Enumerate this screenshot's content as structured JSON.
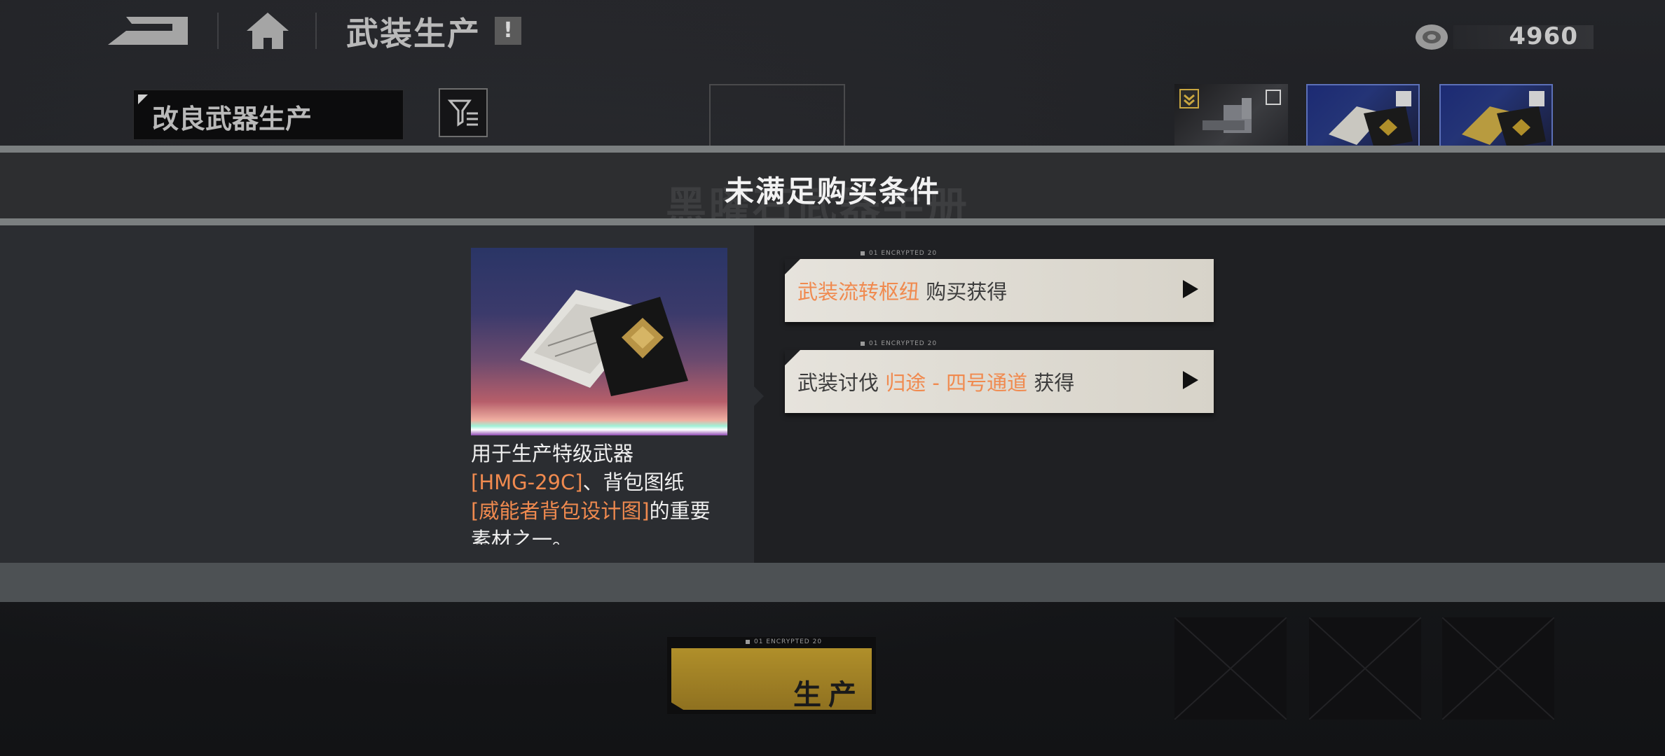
{
  "header": {
    "title": "武装生产",
    "badge": "!",
    "currency_value": "4960"
  },
  "background": {
    "sub_tab_label": "改良武器生产",
    "ghost_title": "黑曜石武器手册"
  },
  "modal": {
    "title": "未满足购买条件",
    "item_description": {
      "line1": "用于生产特级武器",
      "hl1": "[HMG-29C]",
      "mid": "、背包图纸",
      "hl2": "[威能者背包设计图]",
      "tail": "的重要",
      "line4": "素材之一。"
    },
    "sources": [
      {
        "tag": "01 ENCRYPTED 20",
        "prefix": "",
        "highlight": "武装流转枢纽",
        "suffix": " 购买获得"
      },
      {
        "tag": "01 ENCRYPTED 20",
        "prefix": "武装讨伐 ",
        "highlight": "归途 - 四号通道",
        "suffix": "  获得"
      }
    ]
  },
  "footer": {
    "produce_tag": "01 ENCRYPTED 20",
    "produce_label": "生产"
  },
  "colors": {
    "highlight": "#f08a4f",
    "produce_gold": "#b08f2a",
    "modal_header": "#2d2e30"
  }
}
